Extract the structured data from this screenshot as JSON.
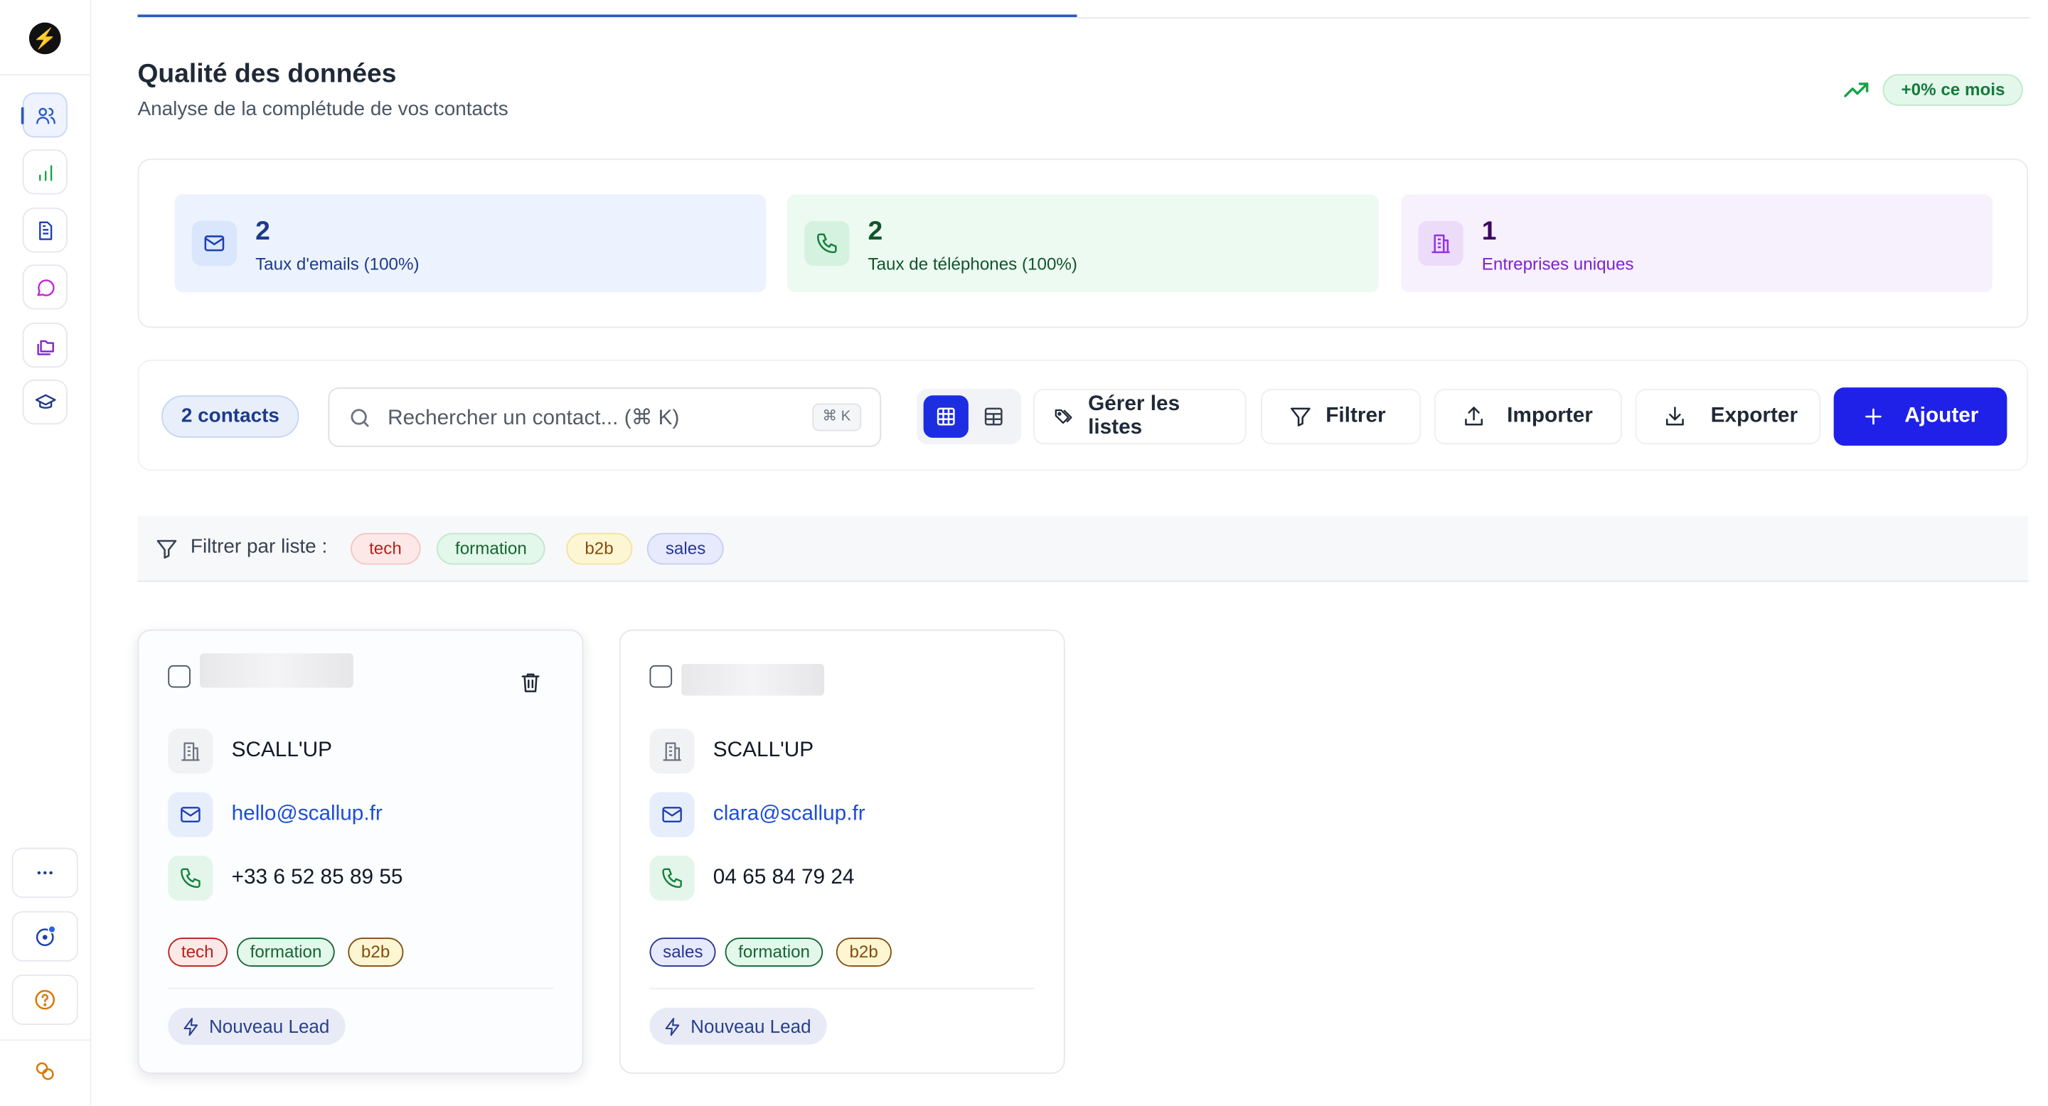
{
  "header": {
    "title": "Qualité des données",
    "subtitle": "Analyse de la complétude de vos contacts",
    "trend_badge": "+0% ce mois"
  },
  "stats": [
    {
      "value": "2",
      "label": "Taux d'emails (100%)",
      "icon": "mail-icon"
    },
    {
      "value": "2",
      "label": "Taux de téléphones (100%)",
      "icon": "phone-icon"
    },
    {
      "value": "1",
      "label": "Entreprises uniques",
      "icon": "building-icon"
    }
  ],
  "toolbar": {
    "count": "2 contacts",
    "search_placeholder": "Rechercher un contact... (⌘ K)",
    "search_shortcut": "⌘ K",
    "manage_lists": "Gérer les listes",
    "filter": "Filtrer",
    "import": "Importer",
    "export": "Exporter",
    "add": "Ajouter"
  },
  "list_filter": {
    "label": "Filtrer par liste :",
    "tags": [
      "tech",
      "formation",
      "b2b",
      "sales"
    ]
  },
  "contacts": [
    {
      "name": "",
      "company": "SCALL'UP",
      "email": "hello@scallup.fr",
      "phone": "+33 6 52 85 89 55",
      "tags": [
        "tech",
        "formation",
        "b2b"
      ],
      "status": "Nouveau Lead"
    },
    {
      "name": "",
      "company": "SCALL'UP",
      "email": "clara@scallup.fr",
      "phone": "04 65 84 79 24",
      "tags": [
        "sales",
        "formation",
        "b2b"
      ],
      "status": "Nouveau Lead"
    }
  ],
  "colors": {
    "accent": "#2b59c3",
    "primary_button": "#1f21e8",
    "trend_green": "#16a34a"
  }
}
